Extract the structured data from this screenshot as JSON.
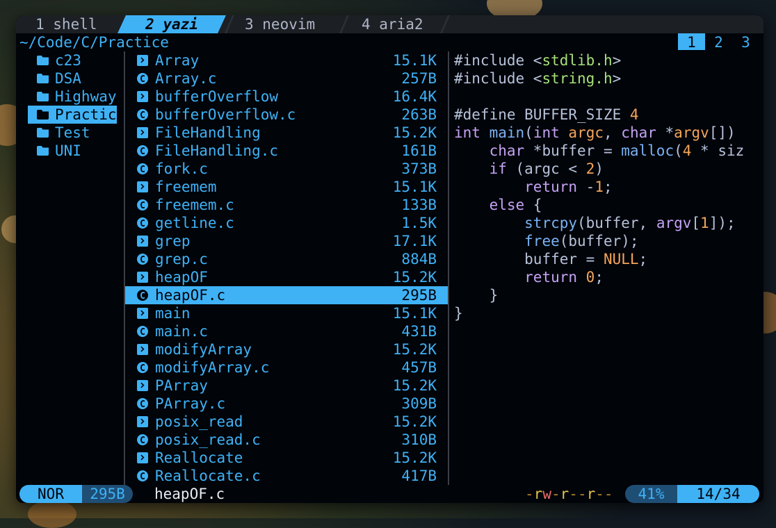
{
  "tabs": [
    {
      "label": "1 shell",
      "active": false
    },
    {
      "label": "2 yazi",
      "active": true
    },
    {
      "label": "3 neovim",
      "active": false
    },
    {
      "label": "4 aria2",
      "active": false
    }
  ],
  "path": "~/Code/C/Practice",
  "tab_numbers": [
    "1",
    "2",
    "3"
  ],
  "parent_dirs": [
    {
      "name": "c23",
      "selected": false
    },
    {
      "name": "DSA",
      "selected": false
    },
    {
      "name": "Highway",
      "selected": false
    },
    {
      "name": "Practic",
      "selected": true
    },
    {
      "name": "Test",
      "selected": false
    },
    {
      "name": "UNI",
      "selected": false
    }
  ],
  "files": [
    {
      "name": "Array",
      "size": "15.1K",
      "type": "exec"
    },
    {
      "name": "Array.c",
      "size": "257B",
      "type": "c"
    },
    {
      "name": "bufferOverflow",
      "size": "16.4K",
      "type": "exec"
    },
    {
      "name": "bufferOverflow.c",
      "size": "263B",
      "type": "c"
    },
    {
      "name": "FileHandling",
      "size": "15.2K",
      "type": "exec"
    },
    {
      "name": "FileHandling.c",
      "size": "161B",
      "type": "c"
    },
    {
      "name": "fork.c",
      "size": "373B",
      "type": "c"
    },
    {
      "name": "freemem",
      "size": "15.1K",
      "type": "exec"
    },
    {
      "name": "freemem.c",
      "size": "133B",
      "type": "c"
    },
    {
      "name": "getline.c",
      "size": "1.5K",
      "type": "c"
    },
    {
      "name": "grep",
      "size": "17.1K",
      "type": "exec"
    },
    {
      "name": "grep.c",
      "size": "884B",
      "type": "c"
    },
    {
      "name": "heapOF",
      "size": "15.2K",
      "type": "exec"
    },
    {
      "name": "heapOF.c",
      "size": "295B",
      "type": "c",
      "selected": true
    },
    {
      "name": "main",
      "size": "15.1K",
      "type": "exec"
    },
    {
      "name": "main.c",
      "size": "431B",
      "type": "c"
    },
    {
      "name": "modifyArray",
      "size": "15.2K",
      "type": "exec"
    },
    {
      "name": "modifyArray.c",
      "size": "457B",
      "type": "c"
    },
    {
      "name": "PArray",
      "size": "15.2K",
      "type": "exec"
    },
    {
      "name": "PArray.c",
      "size": "309B",
      "type": "c"
    },
    {
      "name": "posix_read",
      "size": "15.2K",
      "type": "exec"
    },
    {
      "name": "posix_read.c",
      "size": "310B",
      "type": "c"
    },
    {
      "name": "Reallocate",
      "size": "15.2K",
      "type": "exec"
    },
    {
      "name": "Reallocate.c",
      "size": "417B",
      "type": "c"
    }
  ],
  "preview_lines": [
    [
      [
        "#include ",
        ""
      ],
      [
        "<",
        ""
      ],
      [
        "stdlib.h",
        "str"
      ],
      [
        ">",
        ""
      ]
    ],
    [
      [
        "#include ",
        ""
      ],
      [
        "<",
        ""
      ],
      [
        "string.h",
        "str"
      ],
      [
        ">",
        ""
      ]
    ],
    [],
    [
      [
        "#define BUFFER_SIZE ",
        ""
      ],
      [
        "4",
        "num"
      ]
    ],
    [
      [
        "int",
        "kw"
      ],
      [
        " ",
        ""
      ],
      [
        "main",
        "fn"
      ],
      [
        "(",
        ""
      ],
      [
        "int",
        "kw"
      ],
      [
        " ",
        ""
      ],
      [
        "argc",
        "num"
      ],
      [
        ", ",
        ""
      ],
      [
        "char",
        "kw"
      ],
      [
        " *",
        ""
      ],
      [
        "argv",
        "num"
      ],
      [
        "[])",
        ""
      ]
    ],
    [
      [
        "    ",
        ""
      ],
      [
        "char",
        "kw"
      ],
      [
        " *buffer = ",
        ""
      ],
      [
        "malloc",
        "fn"
      ],
      [
        "(",
        ""
      ],
      [
        "4",
        "num"
      ],
      [
        " * siz",
        ""
      ]
    ],
    [
      [
        "    ",
        ""
      ],
      [
        "if",
        "kw"
      ],
      [
        " (argc < ",
        ""
      ],
      [
        "2",
        "num"
      ],
      [
        ")",
        ""
      ]
    ],
    [
      [
        "        ",
        ""
      ],
      [
        "return",
        "kw"
      ],
      [
        " -",
        ""
      ],
      [
        "1",
        "num"
      ],
      [
        ";",
        ""
      ]
    ],
    [
      [
        "    ",
        ""
      ],
      [
        "else",
        "kw"
      ],
      [
        " {",
        ""
      ]
    ],
    [
      [
        "        ",
        ""
      ],
      [
        "strcpy",
        "fn"
      ],
      [
        "(buffer, ",
        ""
      ],
      [
        "argv",
        "kw"
      ],
      [
        "[",
        ""
      ],
      [
        "1",
        "num"
      ],
      [
        "]);",
        ""
      ]
    ],
    [
      [
        "        ",
        ""
      ],
      [
        "free",
        "fn"
      ],
      [
        "(buffer);",
        ""
      ]
    ],
    [
      [
        "        ",
        ""
      ],
      [
        "buffer = ",
        ""
      ],
      [
        "NULL",
        "num"
      ],
      [
        ";",
        ""
      ]
    ],
    [
      [
        "        ",
        ""
      ],
      [
        "return",
        "kw"
      ],
      [
        " ",
        ""
      ],
      [
        "0",
        "num"
      ],
      [
        ";",
        ""
      ]
    ],
    [
      [
        "    }",
        ""
      ]
    ],
    [
      [
        "}",
        ""
      ]
    ]
  ],
  "status": {
    "mode": "NOR",
    "size": "295B",
    "filename": "heapOF.c",
    "permissions": [
      "-",
      "r",
      "w",
      "-",
      "r",
      "-",
      "-",
      "r",
      "-",
      "-"
    ],
    "percent": "41%",
    "position": "14/34"
  },
  "colors": {
    "accent": "#3fb2f6",
    "background": "#010409",
    "keyword": "#c5a3f5",
    "string": "#a6e07a",
    "number": "#f5a55a"
  }
}
